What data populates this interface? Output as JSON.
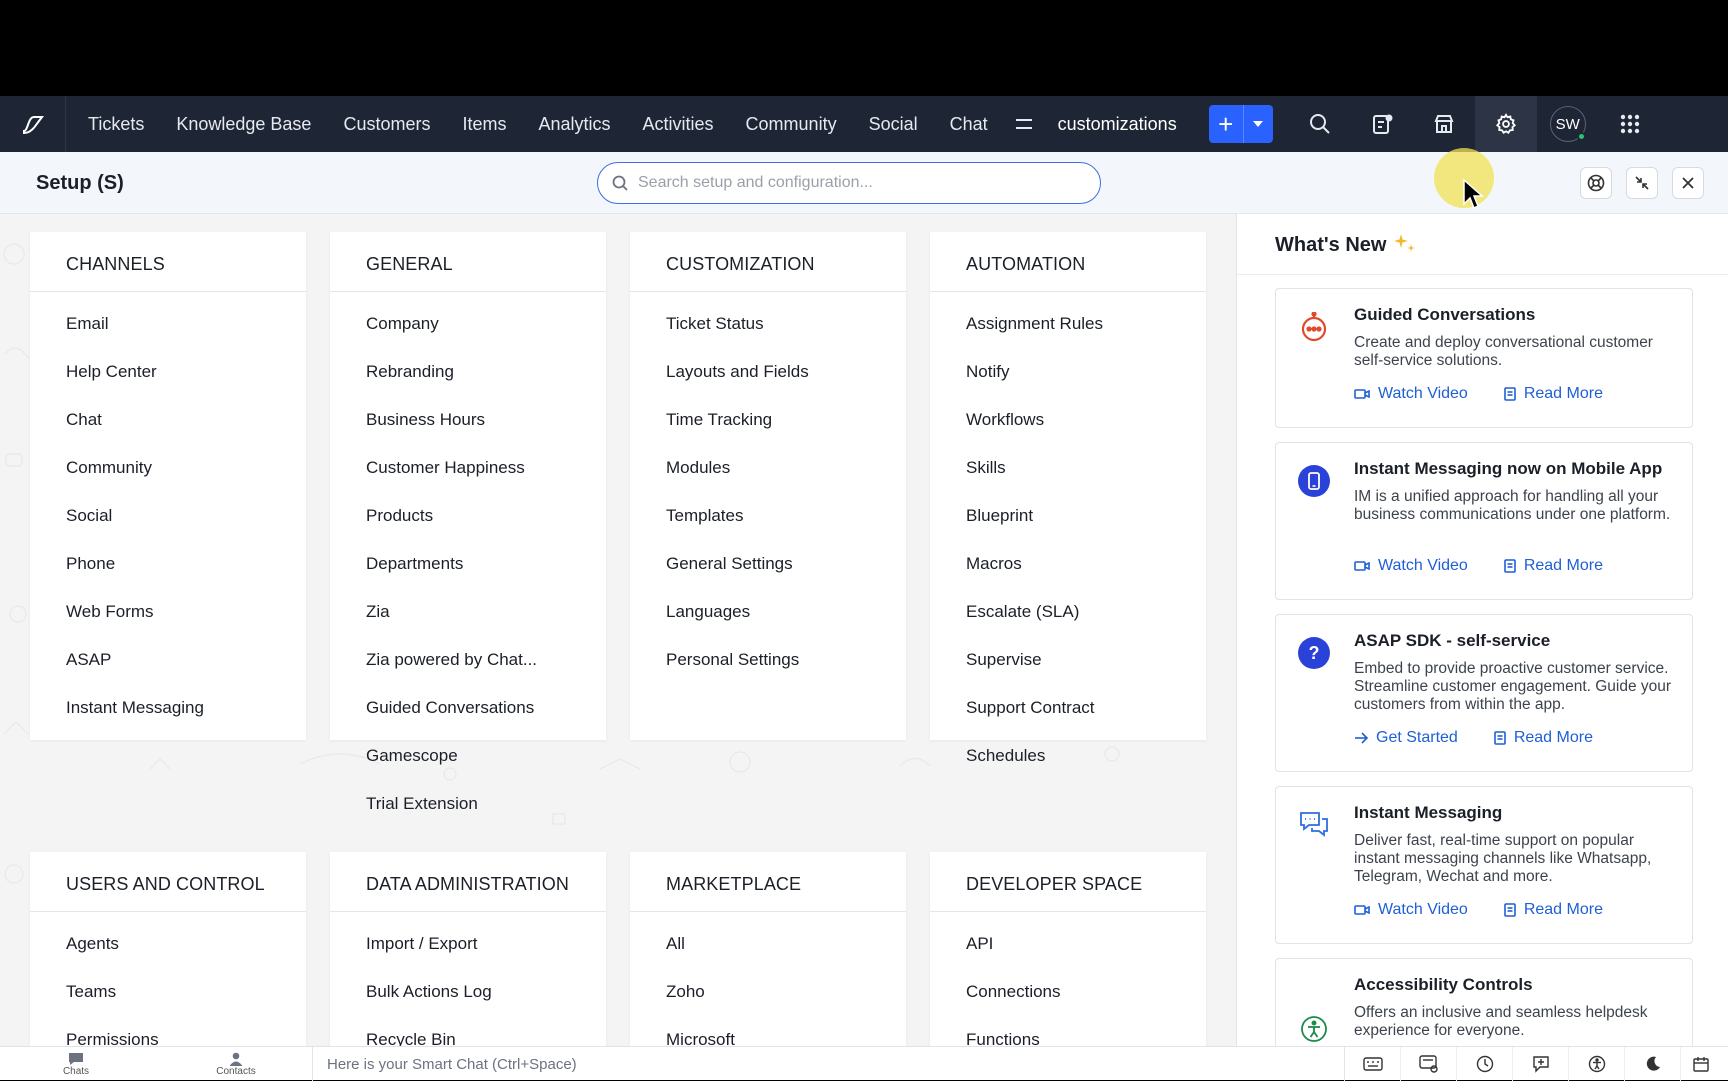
{
  "nav": {
    "tabs": [
      "Tickets",
      "Knowledge Base",
      "Customers",
      "Items",
      "Analytics",
      "Activities",
      "Community",
      "Social",
      "Chat"
    ],
    "current": "customizations",
    "avatar": "SW"
  },
  "setup": {
    "title": "Setup (S)",
    "search_placeholder": "Search setup and configuration..."
  },
  "sections": [
    {
      "title": "CHANNELS",
      "items": [
        "Email",
        "Help Center",
        "Chat",
        "Community",
        "Social",
        "Phone",
        "Web Forms",
        "ASAP",
        "Instant Messaging"
      ]
    },
    {
      "title": "GENERAL",
      "items": [
        "Company",
        "Rebranding",
        "Business Hours",
        "Customer Happiness",
        "Products",
        "Departments",
        "Zia",
        "Zia powered by Chat...",
        "Guided Conversations",
        "Gamescope",
        "Trial Extension"
      ]
    },
    {
      "title": "CUSTOMIZATION",
      "items": [
        "Ticket Status",
        "Layouts and Fields",
        "Time Tracking",
        "Modules",
        "Templates",
        "General Settings",
        "Languages",
        "Personal Settings"
      ]
    },
    {
      "title": "AUTOMATION",
      "items": [
        "Assignment Rules",
        "Notify",
        "Workflows",
        "Skills",
        "Blueprint",
        "Macros",
        "Escalate (SLA)",
        "Supervise",
        "Support Contract",
        "Schedules"
      ]
    },
    {
      "title": "USERS AND CONTROL",
      "items": [
        "Agents",
        "Teams",
        "Permissions"
      ]
    },
    {
      "title": "DATA ADMINISTRATION",
      "items": [
        "Import / Export",
        "Bulk Actions Log",
        "Recycle Bin"
      ]
    },
    {
      "title": "MARKETPLACE",
      "items": [
        "All",
        "Zoho",
        "Microsoft"
      ]
    },
    {
      "title": "DEVELOPER SPACE",
      "items": [
        "API",
        "Connections",
        "Functions"
      ]
    }
  ],
  "whats_new": {
    "title": "What's New",
    "cards": [
      {
        "title": "Guided Conversations",
        "desc": "Create and deploy conversational customer self-service solutions.",
        "links": [
          "Watch Video",
          "Read More"
        ],
        "icon": "bot-icon"
      },
      {
        "title": "Instant Messaging now on Mobile App",
        "desc": "IM is a unified approach for handling all your business communications under one platform.",
        "links": [
          "Watch Video",
          "Read More"
        ],
        "icon": "mobile-icon"
      },
      {
        "title": "ASAP SDK - self-service",
        "desc": "Embed to provide proactive customer service. Streamline customer engagement. Guide your customers from within the app.",
        "links": [
          "Get Started",
          "Read More"
        ],
        "icon": "help-icon"
      },
      {
        "title": "Instant Messaging",
        "desc": "Deliver fast, real-time support on popular instant messaging channels like Whatsapp, Telegram, Wechat and more.",
        "links": [
          "Watch Video",
          "Read More"
        ],
        "icon": "chat-bubbles-icon"
      },
      {
        "title": "Accessibility Controls",
        "desc": "Offers an inclusive and seamless helpdesk experience for everyone.",
        "links": [],
        "icon": "accessibility-icon"
      }
    ]
  },
  "footer": {
    "chats": "Chats",
    "contacts": "Contacts",
    "smart_chat": "Here is your Smart Chat (Ctrl+Space)"
  },
  "colors": {
    "nav_bg": "#1e2534",
    "accent": "#2962ff",
    "link": "#1f5fd6"
  }
}
